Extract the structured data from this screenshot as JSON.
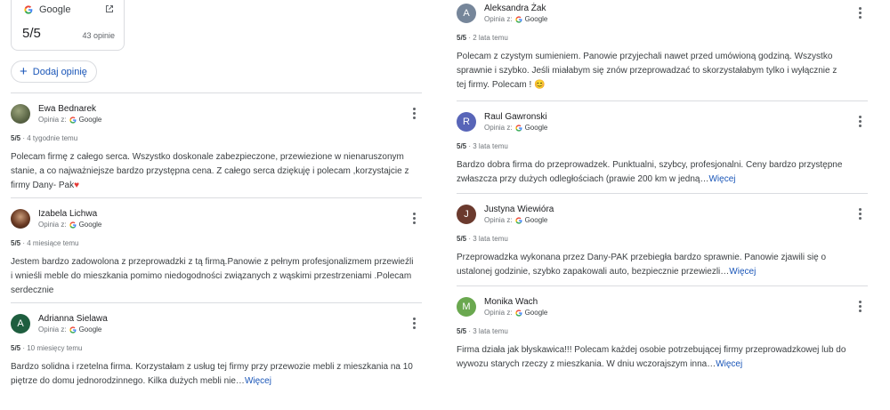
{
  "summary": {
    "source_label": "Google",
    "score": "5/5",
    "count": "43 opinie",
    "icons": {
      "logo": "google-g-icon",
      "external": "open-external-icon"
    }
  },
  "add_review": {
    "label": "Dodaj opinię",
    "icon": "plus-icon"
  },
  "colors": {
    "link": "#1a56b8",
    "divider": "#dadce0"
  },
  "reviews_left": [
    {
      "name": "Ewa Bednarek",
      "source_prefix": "Opinia z:",
      "source": "Google",
      "rating": "5/5",
      "time": "4 tygodnie temu",
      "text": "Polecam firmę z całego serca. Wszystko doskonale zabezpieczone, przewiezione w nienaruszonym stanie, a co najważniejsze bardzo przystępna cena. Z całego serca dziękuję i polecam ,korzystajcie z firmy Dany- Pak",
      "emoji": "♥"
    },
    {
      "name": "Izabela Lichwa",
      "source_prefix": "Opinia z:",
      "source": "Google",
      "rating": "5/5",
      "time": "4 miesiące temu",
      "text": "Jestem bardzo zadowolona z przeprowadzki z tą firmą.Panowie z pełnym profesjonalizmem przewieźli i wnieśli meble do mieszkania pomimo niedogodności związanych z wąskimi przestrzeniami .Polecam serdecznie"
    },
    {
      "name": "Adrianna Sielawa",
      "source_prefix": "Opinia z:",
      "source": "Google",
      "rating": "5/5",
      "time": "10 miesięcy temu",
      "initial": "A",
      "text": "Bardzo solidna i rzetelna firma. Korzystałam z usług tej firmy przy przewozie mebli z mieszkania na 10 piętrze do domu jednorodzinnego. Kilka dużych mebli nie…",
      "more": "Więcej"
    }
  ],
  "reviews_right": [
    {
      "name": "Aleksandra Żak",
      "source_prefix": "Opinia z:",
      "source": "Google",
      "rating": "5/5",
      "time": "2 lata temu",
      "initial": "A",
      "text": "Polecam z czystym sumieniem. Panowie przyjechali nawet przed umówioną godziną. Wszystko sprawnie i szybko. Jeśli miałabym się znów przeprowadzać to skorzystałabym tylko i wyłącznie z tej firmy. Polecam !",
      "emoji": "😊"
    },
    {
      "name": "Raul Gawronski",
      "source_prefix": "Opinia z:",
      "source": "Google",
      "rating": "5/5",
      "time": "3 lata temu",
      "initial": "R",
      "text": "Bardzo dobra firma do przeprowadzek. Punktualni, szybcy, profesjonalni. Ceny bardzo przystępne zwłaszcza przy dużych odległościach (prawie 200 km w jedną…",
      "more": "Więcej"
    },
    {
      "name": "Justyna Wiewióra",
      "source_prefix": "Opinia z:",
      "source": "Google",
      "rating": "5/5",
      "time": "3 lata temu",
      "initial": "J",
      "text": "Przeprowadzka wykonana przez Dany-PAK przebiegła bardzo sprawnie. Panowie zjawili się o ustalonej godzinie, szybko zapakowali auto, bezpiecznie przewiezli…",
      "more": "Więcej"
    },
    {
      "name": "Monika Wach",
      "source_prefix": "Opinia z:",
      "source": "Google",
      "rating": "5/5",
      "time": "3 lata temu",
      "initial": "M",
      "text": "Firma działa jak błyskawica!!! Polecam każdej osobie potrzebującej firmy przeprowadzkowej lub do wywozu starych rzeczy z mieszkania. W dniu wczorajszym inna…",
      "more": "Więcej"
    }
  ]
}
